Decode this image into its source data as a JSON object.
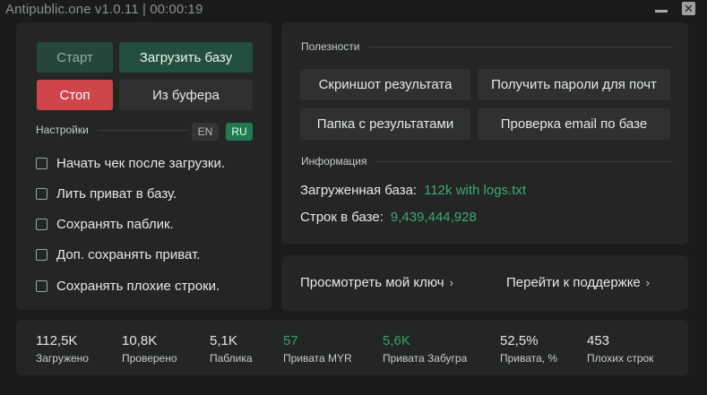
{
  "window": {
    "title": "Antipublic.one v1.0.11 | 00:00:19",
    "minimize_icon": "minimize-icon",
    "close_icon": "close-icon",
    "close_glyph": "✕"
  },
  "controls": {
    "start_label": "Старт",
    "load_db_label": "Загрузить базу",
    "stop_label": "Стоп",
    "from_clipboard_label": "Из буфера"
  },
  "settings": {
    "heading": "Настройки",
    "lang_en": "EN",
    "lang_ru": "RU",
    "active_lang": "RU",
    "options": [
      {
        "label": "Начать чек после загрузки.",
        "checked": false
      },
      {
        "label": "Лить приват в базу.",
        "checked": false
      },
      {
        "label": "Сохранять паблик.",
        "checked": false
      },
      {
        "label": "Доп. сохранять приват.",
        "checked": false
      },
      {
        "label": "Сохранять плохие строки.",
        "checked": false
      }
    ]
  },
  "useful": {
    "heading": "Полезности",
    "buttons": [
      "Скриншот результата",
      "Получить пароли для почт",
      "Папка с результатами",
      "Проверка email по базе"
    ]
  },
  "info": {
    "heading": "Информация",
    "loaded_db_label": "Загруженная база:",
    "loaded_db_value": "112k with logs.txt",
    "lines_label": "Строк в базе:",
    "lines_value": "9,439,444,928"
  },
  "links": {
    "view_key": "Просмотреть мой ключ",
    "support": "Перейти к поддержке",
    "chevron": "›"
  },
  "stats": [
    {
      "value": "112,5K",
      "label": "Загружено",
      "highlight": false
    },
    {
      "value": "10,8K",
      "label": "Проверено",
      "highlight": false
    },
    {
      "value": "5,1K",
      "label": "Паблика",
      "highlight": false
    },
    {
      "value": "57",
      "label": "Привата MYR",
      "highlight": true
    },
    {
      "value": "5,6K",
      "label": "Привата Забугра",
      "highlight": true
    },
    {
      "value": "52,5%",
      "label": "Привата, %",
      "highlight": false
    },
    {
      "value": "453",
      "label": "Плохих строк",
      "highlight": false
    }
  ],
  "colors": {
    "accent_green": "#23794f",
    "value_green": "#3fa775",
    "stop_red": "#d0454a",
    "panel_bg": "#232625",
    "window_bg": "#1a1c1b"
  }
}
